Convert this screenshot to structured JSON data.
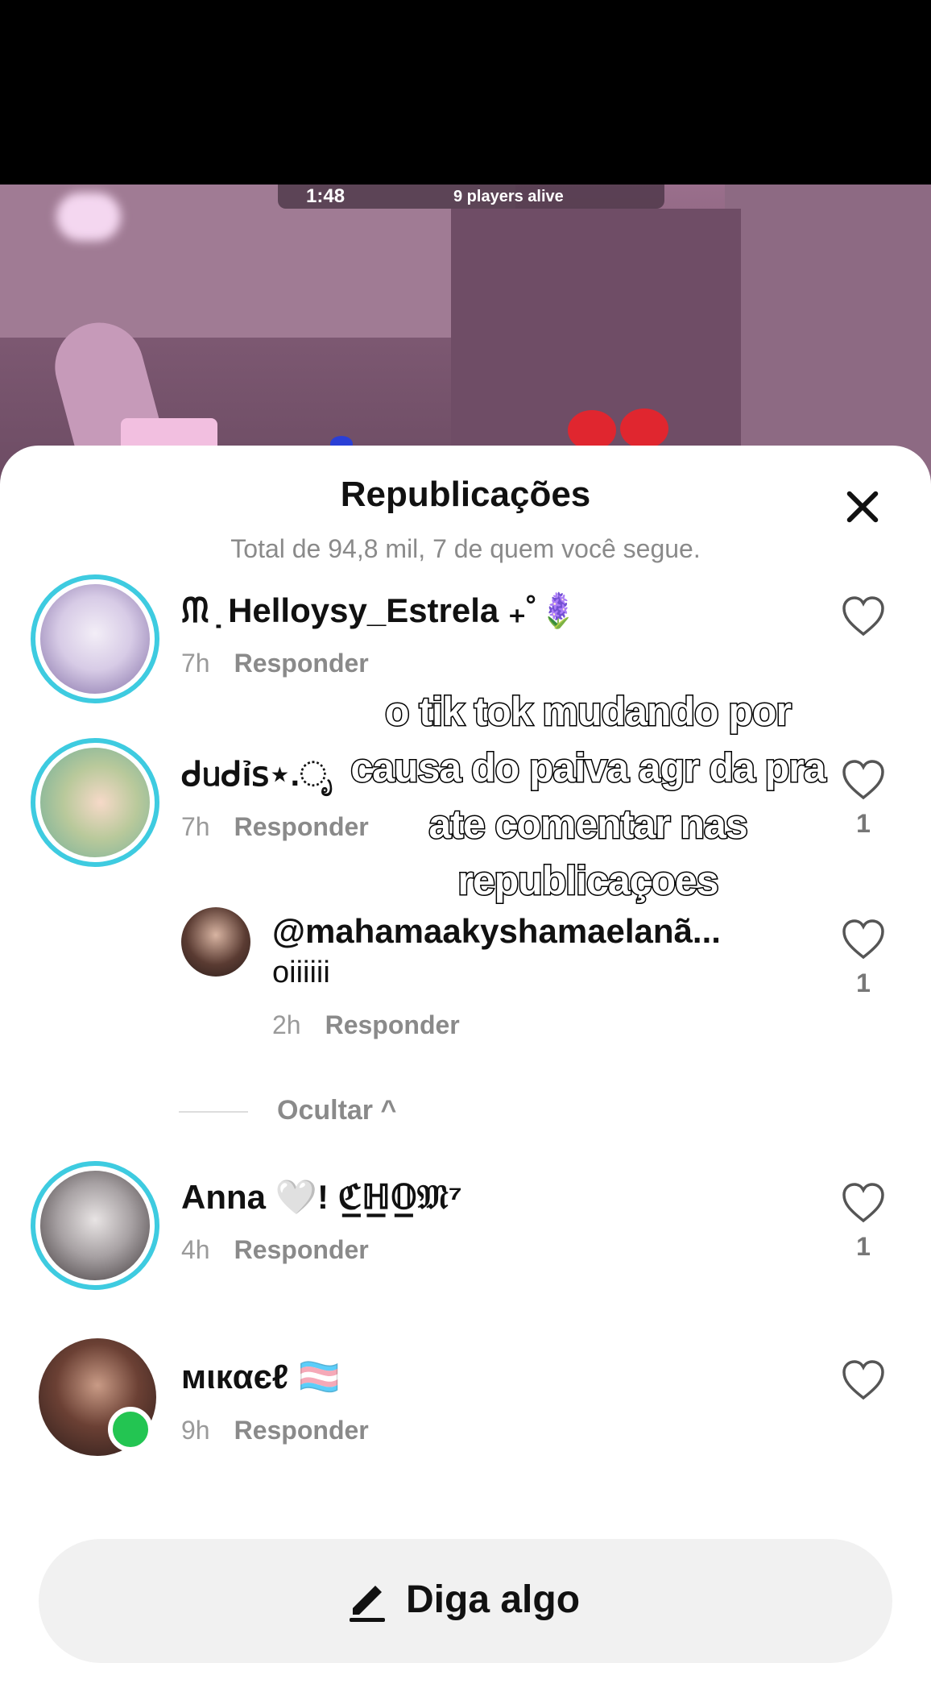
{
  "video": {
    "timer": "1:48",
    "players_alive": "9 players alive"
  },
  "sheet": {
    "title": "Republicações",
    "subtitle": "Total de 94,8 mil, 7 de quem você segue."
  },
  "overlay_text": "o tik tok mudando por causa do paiva agr da pra ate comentar nas republicaçoes",
  "comments": [
    {
      "username": "ᙏ ̣ Helloysy_Estrela ₊˚🪻",
      "time": "7h",
      "reply_label": "Responder",
      "likes": ""
    },
    {
      "username": "ᑯᥙᑯỉ𝗌⋆.ೃ",
      "time": "7h",
      "reply_label": "Responder",
      "likes": "1"
    },
    {
      "username": "@mahamaakyshamaelanã...",
      "text": "oiiiiii",
      "time": "2h",
      "reply_label": "Responder",
      "likes": "1"
    },
    {
      "username": "Anna 🤍!  ℭ̲ℍ̲𝕆̲𝔐⁷",
      "time": "4h",
      "reply_label": "Responder",
      "likes": "1"
    },
    {
      "username": "мιкαєℓ 🏳️‍⚧️",
      "time": "9h",
      "reply_label": "Responder",
      "likes": ""
    }
  ],
  "hide_label": "Ocultar ^",
  "input": {
    "placeholder": "Diga algo",
    "icon": "pencil-icon"
  },
  "colors": {
    "ring": "#3ecbe0",
    "online": "#23c552",
    "background": "#ffffff"
  }
}
